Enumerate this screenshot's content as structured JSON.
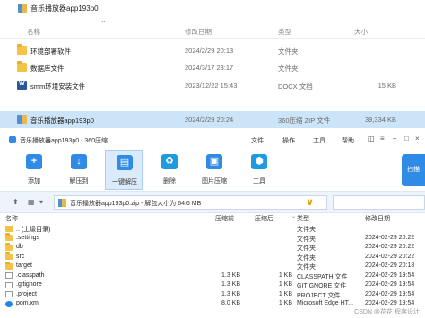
{
  "explorer": {
    "top_item": "音乐播放器app193p0",
    "headers": {
      "name": "名称",
      "date": "修改日期",
      "type": "类型",
      "size": "大小"
    },
    "rows": [
      {
        "name": "环境部署软件",
        "date": "2024/2/29 20:13",
        "type": "文件夹",
        "size": "",
        "icon": "folder-icon"
      },
      {
        "name": "数据库文件",
        "date": "2024/3/17 23:17",
        "type": "文件夹",
        "size": "",
        "icon": "folder-icon"
      },
      {
        "name": "smm环境安装文件",
        "date": "2023/12/22 15:43",
        "type": "DOCX 文档",
        "size": "15 KB",
        "icon": "docx-icon"
      },
      {
        "name": "音乐播放器app193p0",
        "date": "2024/2/29 20:24",
        "type": "360压缩 ZIP 文件",
        "size": "39,334 KB",
        "icon": "zip-icon",
        "selected": true
      }
    ]
  },
  "zip": {
    "title": "音乐播放器app193p0 - 360压缩",
    "menu": [
      "文件",
      "操作",
      "工具",
      "帮助"
    ],
    "toolbar": [
      {
        "label": "添加",
        "icon": "add-icon"
      },
      {
        "label": "解压到",
        "icon": "extract-to-icon"
      },
      {
        "label": "一键解压",
        "icon": "one-click-extract-icon",
        "active": true
      },
      {
        "label": "删除",
        "icon": "delete-icon"
      },
      {
        "label": "图片压缩",
        "icon": "image-compress-icon"
      },
      {
        "label": "工具",
        "icon": "tools-icon"
      }
    ],
    "brand_label": "扫描",
    "address": "音乐播放器app193p0.zip - 解包大小为 64.6 MB",
    "list_headers": {
      "name": "名称",
      "compressed": "压缩前",
      "packed": "压缩后",
      "type": "类型",
      "modified": "修改日期"
    },
    "rows": [
      {
        "name": ".. (上级目录)",
        "c1": "",
        "c2": "",
        "type": "文件夹",
        "date": "",
        "icon": "up-folder-icon"
      },
      {
        "name": ".settings",
        "c1": "",
        "c2": "",
        "type": "文件夹",
        "date": "2024-02-29 20:22",
        "icon": "folder-icon"
      },
      {
        "name": "db",
        "c1": "",
        "c2": "",
        "type": "文件夹",
        "date": "2024-02-29 20:22",
        "icon": "folder-icon"
      },
      {
        "name": "src",
        "c1": "",
        "c2": "",
        "type": "文件夹",
        "date": "2024-02-29 20:22",
        "icon": "folder-icon"
      },
      {
        "name": "target",
        "c1": "",
        "c2": "",
        "type": "文件夹",
        "date": "2024-02-29 20:18",
        "icon": "folder-icon"
      },
      {
        "name": ".classpath",
        "c1": "1.3 KB",
        "c2": "1 KB",
        "type": "CLASSPATH 文件",
        "date": "2024-02-29 19:54",
        "icon": "file-icon"
      },
      {
        "name": ".gitignore",
        "c1": "1.3 KB",
        "c2": "1 KB",
        "type": "GITIGNORE 文件",
        "date": "2024-02-29 19:54",
        "icon": "file-icon"
      },
      {
        "name": ".project",
        "c1": "1.3 KB",
        "c2": "1 KB",
        "type": "PROJECT 文件",
        "date": "2024-02-29 19:54",
        "icon": "file-icon"
      },
      {
        "name": "pom.xml",
        "c1": "8.0 KB",
        "c2": "1 KB",
        "type": "Microsoft Edge HT...",
        "date": "2024-02-29 19:54",
        "icon": "edge-icon"
      }
    ]
  },
  "watermark": "CSDN @花花 程序设计"
}
